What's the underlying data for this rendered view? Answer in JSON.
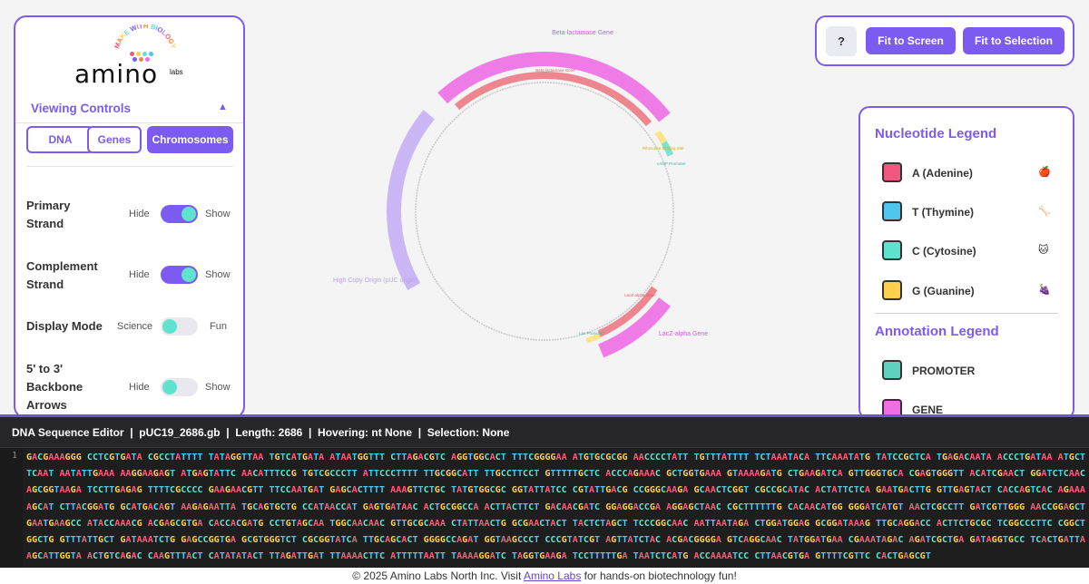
{
  "logo": {
    "arc_text": "MAKE WITH BIOLOGY",
    "wordmark": "amino",
    "suffix": "labs"
  },
  "viewing_controls": {
    "title": "Viewing Controls",
    "collapse_icon": "chevron-up-icon",
    "modes": [
      "DNA",
      "Genes",
      "Chromosomes"
    ],
    "active_mode": "Chromosomes",
    "controls": [
      {
        "label": "Primary Strand",
        "off": "Hide",
        "on": "Show",
        "enabled": true
      },
      {
        "label": "Complement Strand",
        "off": "Hide",
        "on": "Show",
        "enabled": true
      },
      {
        "label": "Display Mode",
        "off": "Science",
        "on": "Fun",
        "enabled": false
      },
      {
        "label": "5' to 3' Backbone Arrows",
        "off": "Hide",
        "on": "Show",
        "enabled": false
      }
    ]
  },
  "toolbar": {
    "help_label": "?",
    "fit_screen_label": "Fit to Screen",
    "fit_selection_label": "Fit to Selection"
  },
  "legend": {
    "nucleotide_title": "Nucleotide Legend",
    "nucleotides": [
      {
        "label": "A (Adenine)",
        "color": "#f0567e",
        "icon": "apple-icon",
        "emoji": "🍎"
      },
      {
        "label": "T (Thymine)",
        "color": "#4fc6f0",
        "icon": "bone-icon",
        "emoji": "🦴"
      },
      {
        "label": "C (Cytosine)",
        "color": "#5fe3cf",
        "icon": "cat-icon",
        "emoji": "🐱"
      },
      {
        "label": "G (Guanine)",
        "color": "#ffd04d",
        "icon": "grapes-icon",
        "emoji": "🍇"
      }
    ],
    "annotation_title": "Annotation Legend",
    "annotations": [
      {
        "label": "PROMOTER",
        "color": "#5fd3c0"
      },
      {
        "label": "GENE",
        "color": "#ee6ee6"
      }
    ]
  },
  "plasmid": {
    "labels": {
      "beta_lactamase_gene": "Beta-lactamase Gene",
      "beta_lactamase_inner": "Beta-lactamase Gene",
      "high_copy_origin": "High Copy Origin (pUC origin)",
      "lacz_alpha": "LacZ-alpha Gene",
      "lacz_alpha_inner": "LacZ-alpha Gene",
      "camp_promoter": "cAMP Promoter",
      "lac_promoter": "Lac Promoter",
      "ribosome_site": "Ribosome Binding Site"
    },
    "colors": {
      "gene": "#ee6ee6",
      "origin": "#c9b3f5",
      "inner": "#ec7a84",
      "promoter": "#7fe0d4",
      "rbs": "#ffe28a",
      "backbone": "#c8c8c8"
    }
  },
  "editor": {
    "header": "DNA Sequence Editor  |  pUC19_2686.gb  |  Length: 2686  |  Hovering: nt None  |  Selection: None",
    "line_number": "1",
    "sequence": "GACGAAAGGG CCTCGTGATA CGCCTATTTT TATAGGTTAA TGTCATGATA ATAATGGTTT CTTAGACGTC AGGTGGCACT TTTCGGGGAA ATGTGCGCGG AACCCCTATT TGTTTATTTT TCTAAATACA TTCAAATATG TATCCGCTCA TGAGACAATA ACCCTGATAA ATGCTTCAAT AATATTGAAA AAGGAAGAGT ATGAGTATTC AACATTTCCG TGTCGCCCTT ATTCCCTTTT TTGCGGCATT TTGCCTTCCT GTTTTTGCTC ACCCAGAAAC GCTGGTGAAA GTAAAAGATG CTGAAGATCA GTTGGGTGCA CGAGTGGGTT ACATCGAACT GGATCTCAAC AGCGGTAAGA TCCTTGAGAG TTTTCGCCCC GAAGAACGTT TTCCAATGAT GAGCACTTTT AAAGTTCTGC TATGTGGCGC GGTATTATCC CGTATTGACG CCGGGCAAGA GCAACTCGGT CGCCGCATAC ACTATTCTCA GAATGACTTG GTTGAGTACT CACCAGTCAC AGAAAAGCAT CTTACGGATG GCATGACAGT AAGAGAATTA TGCAGTGCTG CCATAACCAT GAGTGATAAC ACTGCGGCCA ACTTACTTCT GACAACGATC GGAGGACCGA AGGAGCTAAC CGCTTTTTTG CACAACATGG GGGATCATGT AACTCGCCTT GATCGTTGGG AACCGGAGCT GAATGAAGCC ATACCAAACG ACGAGCGTGA CACCACGATG CCTGTAGCAA TGGCAACAAC GTTGCGCAAA CTATTAACTG GCGAACTACT TACTCTAGCT TCCCGGCAAC AATTAATAGA CTGGATGGAG GCGGATAAAG TTGCAGGACC ACTTCTGCGC TCGGCCCTTC CGGCTGGCTG GTTTATTGCT GATAAATCTG GAGCCGGTGA GCGTGGGTCT CGCGGTATCA TTGCAGCACT GGGGCCAGAT GGTAAGCCCT CCCGTATCGT AGTTATCTAC ACGACGGGGA GTCAGGCAAC TATGGATGAA CGAAATAGAC AGATCGCTGA GATAGGTGCC TCACTGATTA AGCATTGGTA ACTGTCAGAC CAAGTTTACT CATATATACT TTAGATTGAT TTAAAACTTC ATTTTTAATT TAAAAGGATC TAGGTGAAGA TCCTTTTTGA TAATCTCATG ACCAAAATCC CTTAACGTGA GTTTTCGTTC CACTGAGCGT"
  },
  "footer": {
    "prefix": "© 2025 Amino Labs North Inc. Visit ",
    "link": "Amino Labs",
    "suffix": " for hands-on biotechnology fun!"
  }
}
